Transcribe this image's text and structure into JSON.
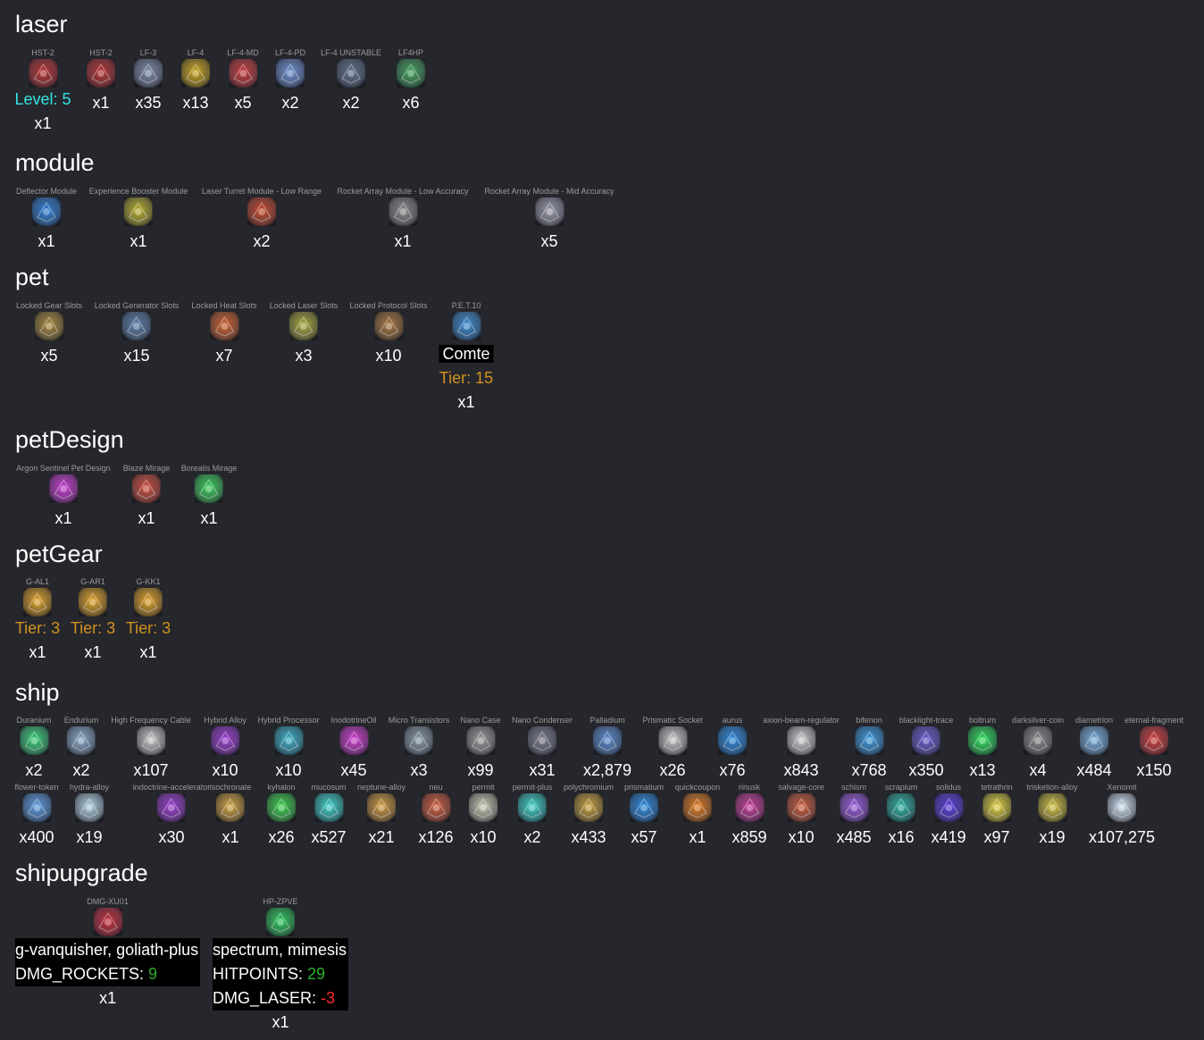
{
  "sections": {
    "laser": {
      "title": "laser",
      "items": [
        {
          "name": "HST-2",
          "level_label": "Level:",
          "level_value": "5",
          "count": "x1",
          "color": "#b83030"
        },
        {
          "name": "HST-2",
          "count": "x1",
          "color": "#b83030"
        },
        {
          "name": "LF-3",
          "count": "x35",
          "color": "#7d8aa8"
        },
        {
          "name": "LF-4",
          "count": "x13",
          "color": "#c8a419"
        },
        {
          "name": "LF-4-MD",
          "count": "x5",
          "color": "#c83a3a"
        },
        {
          "name": "LF-4-PD",
          "count": "x2",
          "color": "#6c8fd0"
        },
        {
          "name": "LF-4 UNSTABLE",
          "count": "x2",
          "color": "#5e6e88"
        },
        {
          "name": "LF4HP",
          "count": "x6",
          "color": "#3fa05a"
        }
      ]
    },
    "module": {
      "title": "module",
      "items": [
        {
          "name": "Deflector Module",
          "count": "x1",
          "color": "#2d7fd6"
        },
        {
          "name": "Experience Booster Module",
          "count": "x1",
          "color": "#b8b02a"
        },
        {
          "name": "Laser Turret Module - Low Range",
          "count": "x2",
          "color": "#c8482a"
        },
        {
          "name": "Rocket Array Module - Low Accuracy",
          "count": "x1",
          "color": "#8a8a8a"
        },
        {
          "name": "Rocket Array Module - Mid Accuracy",
          "count": "x5",
          "color": "#9a9aa8"
        }
      ]
    },
    "pet": {
      "title": "pet",
      "items": [
        {
          "name": "Locked Gear Slots",
          "count": "x5",
          "color": "#a88a3a"
        },
        {
          "name": "Locked Generator Slots",
          "count": "x15",
          "color": "#5a7fa8"
        },
        {
          "name": "Locked Heat Slots",
          "count": "x7",
          "color": "#d0602a"
        },
        {
          "name": "Locked Laser Slots",
          "count": "x3",
          "color": "#a8a83a"
        },
        {
          "name": "Locked Protocol Slots",
          "count": "x10",
          "color": "#a8743a"
        },
        {
          "name": "P.E.T.10",
          "badge": "Comte",
          "tier_label": "Tier:",
          "tier_value": "15",
          "count": "x1",
          "color": "#3a8ad0"
        }
      ]
    },
    "petDesign": {
      "title": "petDesign",
      "items": [
        {
          "name": "Argon Sentinel Pet Design",
          "count": "x1",
          "color": "#c83ad0"
        },
        {
          "name": "Blaze Mirage",
          "count": "x1",
          "color": "#d04a3a"
        },
        {
          "name": "Borealis Mirage",
          "count": "x1",
          "color": "#3ad05a"
        }
      ]
    },
    "petGear": {
      "title": "petGear",
      "items": [
        {
          "name": "G-AL1",
          "tier_label": "Tier:",
          "tier_value": "3",
          "count": "x1",
          "color": "#e0a020"
        },
        {
          "name": "G-AR1",
          "tier_label": "Tier:",
          "tier_value": "3",
          "count": "x1",
          "color": "#e0a020"
        },
        {
          "name": "G-KK1",
          "tier_label": "Tier:",
          "tier_value": "3",
          "count": "x1",
          "color": "#e0a020"
        }
      ]
    },
    "ship": {
      "title": "ship",
      "row1": [
        {
          "name": "Duranium",
          "count": "x2",
          "color": "#3ad07a"
        },
        {
          "name": "Endurium",
          "count": "x2",
          "color": "#8aa8c8"
        },
        {
          "name": "High Frequency Cable",
          "count": "x107",
          "color": "#c8c8c8"
        },
        {
          "name": "Hybrid Alloy",
          "count": "x10",
          "color": "#9a3ad0"
        },
        {
          "name": "Hybrid Processor",
          "count": "x10",
          "color": "#3ab0c8"
        },
        {
          "name": "InodotrineOil",
          "count": "x45",
          "color": "#d03ad0"
        },
        {
          "name": "Micro Transistors",
          "count": "x3",
          "color": "#8a9aa8"
        },
        {
          "name": "Nano Case",
          "count": "x99",
          "color": "#9a9a9a"
        },
        {
          "name": "Nano Condenser",
          "count": "x31",
          "color": "#7a7a8a"
        },
        {
          "name": "Palladium",
          "count": "x2,879",
          "color": "#5a8ad0"
        },
        {
          "name": "Prismatic Socket",
          "count": "x26",
          "color": "#c8c8c8"
        },
        {
          "name": "aurus",
          "count": "x76",
          "color": "#2a8ae0"
        },
        {
          "name": "axion-beam-regulator",
          "count": "x843",
          "color": "#d0d0d0"
        },
        {
          "name": "bifenon",
          "count": "x768",
          "color": "#3a9ae0"
        },
        {
          "name": "blacklight-trace",
          "count": "x350",
          "color": "#6a5ad0"
        },
        {
          "name": "boltrum",
          "count": "x13",
          "color": "#2ae05a"
        },
        {
          "name": "darksilver-coin",
          "count": "x4",
          "color": "#8a8a8a"
        },
        {
          "name": "diametrion",
          "count": "x484",
          "color": "#7ab0e0"
        },
        {
          "name": "eternal-fragment",
          "count": "x150",
          "color": "#d03a3a"
        }
      ],
      "row2": [
        {
          "name": "flower-token",
          "count": "x400",
          "color": "#5a9ae0"
        },
        {
          "name": "hydra-alloy",
          "count": "x19",
          "color": "#b0d0e0"
        },
        {
          "name": "indoctrine-accelerator",
          "count": "x30",
          "color": "#9a3ad0"
        },
        {
          "name": "isochronate",
          "count": "x1",
          "color": "#d0a03a"
        },
        {
          "name": "kyhalon",
          "count": "x26",
          "color": "#3ad04a"
        },
        {
          "name": "mucosum",
          "count": "x527",
          "color": "#3ad0c8"
        },
        {
          "name": "neptune-alloy",
          "count": "x21",
          "color": "#d09a3a"
        },
        {
          "name": "neu",
          "count": "x126",
          "color": "#d05a3a"
        },
        {
          "name": "permit",
          "count": "x10",
          "color": "#c8c8b0"
        },
        {
          "name": "permit-plus",
          "count": "x2",
          "color": "#3ad0c8"
        },
        {
          "name": "polychromium",
          "count": "x433",
          "color": "#c8a03a"
        },
        {
          "name": "prismatium",
          "count": "x57",
          "color": "#2a8ae0"
        },
        {
          "name": "quickcoupon",
          "count": "x1",
          "color": "#e07a1a"
        },
        {
          "name": "rinusk",
          "count": "x859",
          "color": "#c83a9a"
        },
        {
          "name": "salvage-core",
          "count": "x10",
          "color": "#d05a3a"
        },
        {
          "name": "schism",
          "count": "x485",
          "color": "#9a5ae0"
        },
        {
          "name": "scrapium",
          "count": "x16",
          "color": "#2ab0a0"
        },
        {
          "name": "solidus",
          "count": "x419",
          "color": "#5a3ae0"
        },
        {
          "name": "tetrathrin",
          "count": "x97",
          "color": "#e0d03a"
        },
        {
          "name": "triskelion-alloy",
          "count": "x19",
          "color": "#d0c03a"
        },
        {
          "name": "Xenomit",
          "count": "x107,275",
          "color": "#d0e0f0"
        }
      ]
    },
    "shipupgrade": {
      "title": "shipupgrade",
      "items": [
        {
          "name": "DMG-XU01",
          "ships": "g-vanquisher, goliath-plus",
          "stats": [
            {
              "label": "DMG_ROCKETS:",
              "value": "9",
              "sign": "pos"
            }
          ],
          "count": "x1",
          "color": "#c82a3a"
        },
        {
          "name": "HP-ZPVE",
          "ships": "spectrum, mimesis",
          "stats": [
            {
              "label": "HITPOINTS:",
              "value": "29",
              "sign": "pos"
            },
            {
              "label": "DMG_LASER:",
              "value": "-3",
              "sign": "neg"
            }
          ],
          "count": "x1",
          "color": "#2ac85a"
        }
      ]
    }
  }
}
